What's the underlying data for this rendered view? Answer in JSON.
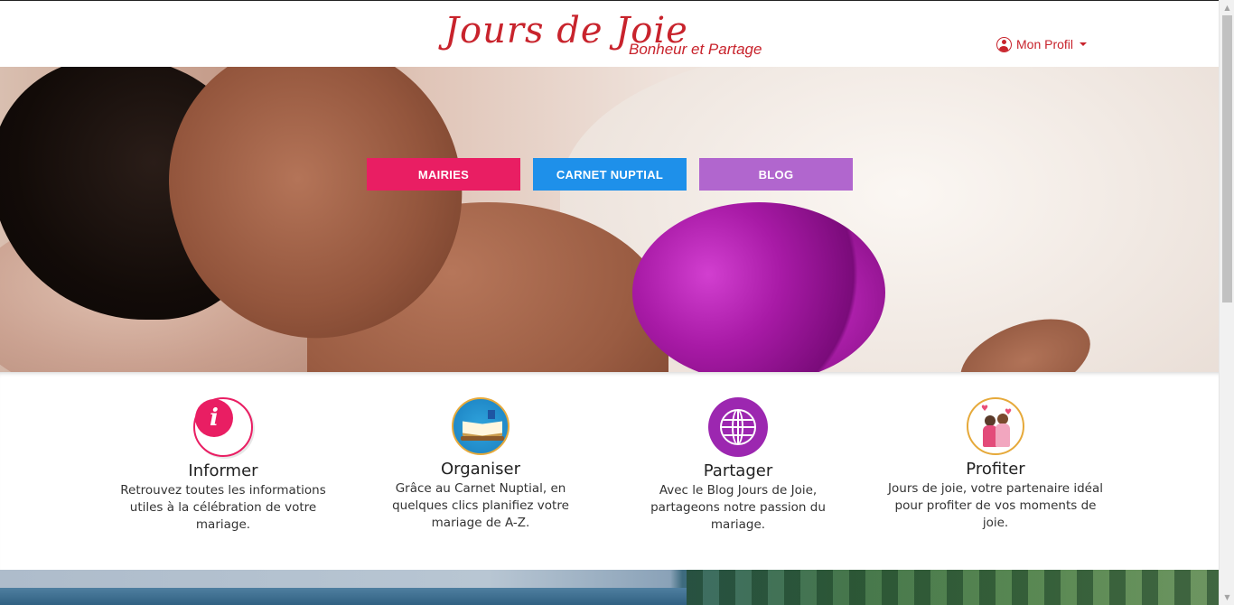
{
  "header": {
    "logo_title": "Jours  de  Joie",
    "logo_subtitle": "Bonheur et Partage",
    "profile_label": "Mon Profil"
  },
  "hero": {
    "nav": [
      {
        "label": "MAIRIES",
        "color": "#e91e63"
      },
      {
        "label": "CARNET NUPTIAL",
        "color": "#1e90ea"
      },
      {
        "label": "BLOG",
        "color": "#b166ce"
      }
    ]
  },
  "features": [
    {
      "title": "Informer",
      "icon": "info-icon",
      "description": "Retrouvez toutes les informations utiles à la célébration de votre mariage."
    },
    {
      "title": "Organiser",
      "icon": "book-icon",
      "description": "Grâce au Carnet Nuptial, en quelques clics planifiez votre mariage de A-Z."
    },
    {
      "title": "Partager",
      "icon": "globe-icon",
      "description": "Avec le Blog Jours de Joie, partageons notre passion du mariage."
    },
    {
      "title": "Profiter",
      "icon": "couple-icon",
      "description": "Jours de joie, votre partenaire idéal pour profiter de vos moments de joie."
    }
  ],
  "colors": {
    "brand": "#c8232c",
    "informer": "#e91e63",
    "partager": "#9c27b0"
  }
}
